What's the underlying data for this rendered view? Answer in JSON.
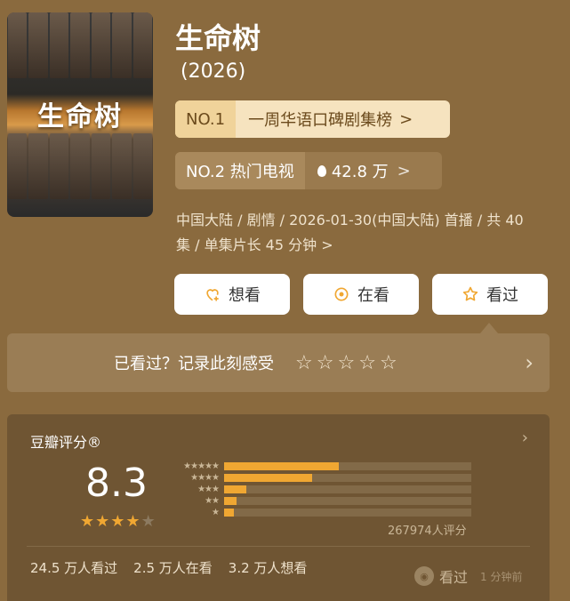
{
  "header": {
    "title": "生命树",
    "year": "(2026)"
  },
  "poster": {
    "title": "生命树"
  },
  "ranks": {
    "first": {
      "tag": "NO.1",
      "label": "一周华语口碑剧集榜",
      "arrow": ">"
    },
    "second": {
      "tag": "NO.2 热门电视",
      "heat": "42.8 万",
      "arrow": ">"
    }
  },
  "meta": {
    "text": "中国大陆 / 剧情 / 2026-01-30(中国大陆) 首播 / 共 40 集 / 单集片长 45 分钟",
    "arrow": ">"
  },
  "actions": {
    "want": "想看",
    "watching": "在看",
    "watched": "看过"
  },
  "record": {
    "prompt": "已看过？记录此刻感受",
    "chevron": "›"
  },
  "rating": {
    "header": "豆瓣评分®",
    "score": "8.3",
    "stars_filled": 4,
    "distribution": [
      {
        "stars": "★★★★★",
        "value": 0.465
      },
      {
        "stars": "★★★★",
        "value": 0.355
      },
      {
        "stars": "★★★",
        "value": 0.09
      },
      {
        "stars": "★★",
        "value": 0.05
      },
      {
        "stars": "★",
        "value": 0.04
      }
    ],
    "count": "267974人评分",
    "stats": {
      "watched": "24.5 万人看过",
      "watching": "2.5 万人在看",
      "want": "3.2 万人想看"
    },
    "seen": {
      "label": "看过",
      "ago": "1 分钟前"
    }
  },
  "colors": {
    "background": "#8a6a3e",
    "accent": "#f0a732"
  }
}
